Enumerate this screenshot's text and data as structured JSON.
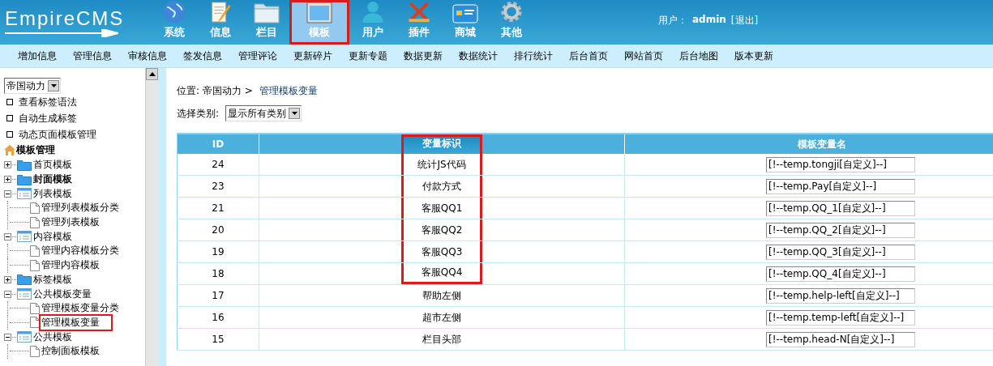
{
  "header": {
    "logo": "EmpireCMS",
    "nav": [
      {
        "label": "系统",
        "selected": false
      },
      {
        "label": "信息",
        "selected": false
      },
      {
        "label": "栏目",
        "selected": false
      },
      {
        "label": "模板",
        "selected": true
      },
      {
        "label": "用户",
        "selected": false
      },
      {
        "label": "插件",
        "selected": false
      },
      {
        "label": "商城",
        "selected": false
      },
      {
        "label": "其他",
        "selected": false
      }
    ],
    "user_label": "用户：",
    "user_name": "admin",
    "logout": "[退出]"
  },
  "subnav": [
    "增加信息",
    "管理信息",
    "审核信息",
    "签发信息",
    "管理评论",
    "更新碎片",
    "更新专题",
    "数据更新",
    "数据统计",
    "排行统计",
    "后台首页",
    "网站首页",
    "后台地图",
    "版本更新"
  ],
  "sidebar": {
    "site_select": "帝国动力",
    "links": [
      "查看标签语法",
      "自动生成标签",
      "动态页面模板管理"
    ],
    "tree": {
      "label": "模板管理",
      "children": [
        {
          "label": "首页模板",
          "kind": "folder",
          "expanded": false,
          "bold": false
        },
        {
          "label": "封面模板",
          "kind": "folder",
          "expanded": false,
          "bold": true
        },
        {
          "label": "列表模板",
          "kind": "folder",
          "expanded": true,
          "bold": false,
          "children": [
            {
              "label": "管理列表模板分类",
              "kind": "page",
              "selected": false
            },
            {
              "label": "管理列表模板",
              "kind": "page",
              "selected": false
            }
          ]
        },
        {
          "label": "内容模板",
          "kind": "folder",
          "expanded": true,
          "bold": false,
          "children": [
            {
              "label": "管理内容模板分类",
              "kind": "page",
              "selected": false
            },
            {
              "label": "管理内容模板",
              "kind": "page",
              "selected": false
            }
          ]
        },
        {
          "label": "标签模板",
          "kind": "folder",
          "expanded": false,
          "bold": false
        },
        {
          "label": "公共模板变量",
          "kind": "folder",
          "expanded": true,
          "bold": false,
          "children": [
            {
              "label": "管理模板变量分类",
              "kind": "page",
              "selected": false
            },
            {
              "label": "管理模板变量",
              "kind": "page",
              "selected": true
            }
          ]
        },
        {
          "label": "公共模板",
          "kind": "folder",
          "expanded": true,
          "bold": false,
          "children": [
            {
              "label": "控制面板模板",
              "kind": "page",
              "selected": false
            }
          ]
        }
      ]
    }
  },
  "main": {
    "breadcrumb_label": "位置: 帝国动力 >",
    "breadcrumb_link": "管理模板变量",
    "filter_label": "选择类别:",
    "filter_value": "显示所有类别",
    "table": {
      "columns": [
        {
          "label": "ID",
          "highlighted": false
        },
        {
          "label": "变量标识",
          "highlighted": true
        },
        {
          "label": "模板变量名",
          "highlighted": false
        }
      ],
      "rows": [
        {
          "id": "24",
          "mark": "统计JS代码",
          "name": "[!--temp.tongji[自定义]--]",
          "highlighted": true
        },
        {
          "id": "23",
          "mark": "付款方式",
          "name": "[!--temp.Pay[自定义]--]",
          "highlighted": true
        },
        {
          "id": "21",
          "mark": "客服QQ1",
          "name": "[!--temp.QQ_1[自定义]--]",
          "highlighted": true
        },
        {
          "id": "20",
          "mark": "客服QQ2",
          "name": "[!--temp.QQ_2[自定义]--]",
          "highlighted": true
        },
        {
          "id": "19",
          "mark": "客服QQ3",
          "name": "[!--temp.QQ_3[自定义]--]",
          "highlighted": true
        },
        {
          "id": "18",
          "mark": "客服QQ4",
          "name": "[!--temp.QQ_4[自定义]--]",
          "highlighted": true
        },
        {
          "id": "17",
          "mark": "帮助左侧",
          "name": "[!--temp.help-left[自定义]--]",
          "highlighted": false
        },
        {
          "id": "16",
          "mark": "超市左侧",
          "name": "[!--temp.temp-left[自定义]--]",
          "highlighted": false
        },
        {
          "id": "15",
          "mark": "栏目头部",
          "name": "[!--temp.head-N[自定义]--]",
          "highlighted": false
        }
      ]
    }
  }
}
